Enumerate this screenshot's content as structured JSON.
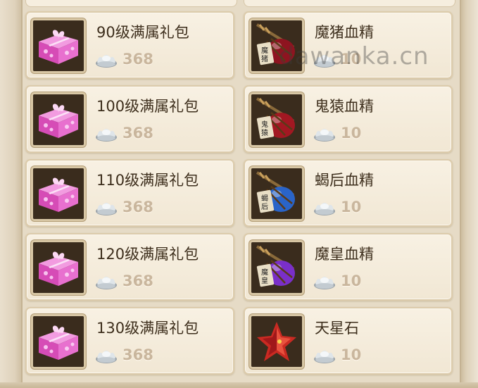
{
  "left_column": [
    {
      "name": "90级满属礼包",
      "price": "368",
      "icon": "pink-gift-box-icon"
    },
    {
      "name": "100级满属礼包",
      "price": "368",
      "icon": "pink-gift-box-icon"
    },
    {
      "name": "110级满属礼包",
      "price": "368",
      "icon": "pink-gift-box-icon"
    },
    {
      "name": "120级满属礼包",
      "price": "368",
      "icon": "pink-gift-box-icon"
    },
    {
      "name": "130级满属礼包",
      "price": "368",
      "icon": "pink-gift-box-icon"
    }
  ],
  "right_column": [
    {
      "name": "魔猪血精",
      "price": "10",
      "icon": "blood-essence-gourd-icon",
      "tag": "魔猪",
      "color": "#8e1420"
    },
    {
      "name": "鬼猿血精",
      "price": "10",
      "icon": "blood-essence-gourd-icon",
      "tag": "鬼猿",
      "color": "#a21822"
    },
    {
      "name": "蝎后血精",
      "price": "10",
      "icon": "blood-essence-gourd-icon",
      "tag": "蝎后",
      "color": "#2a64c8"
    },
    {
      "name": "魔皇血精",
      "price": "10",
      "icon": "blood-essence-gourd-icon",
      "tag": "魔皇",
      "color": "#7a2fc8"
    },
    {
      "name": "天星石",
      "price": "10",
      "icon": "red-star-stone-icon"
    }
  ],
  "currency_icon": "silver-ingot-icon",
  "watermark": "dawanka.cn",
  "colors": {
    "gift": "#e25bc8",
    "price": "#c9b69d",
    "name": "#3d2e1c"
  }
}
